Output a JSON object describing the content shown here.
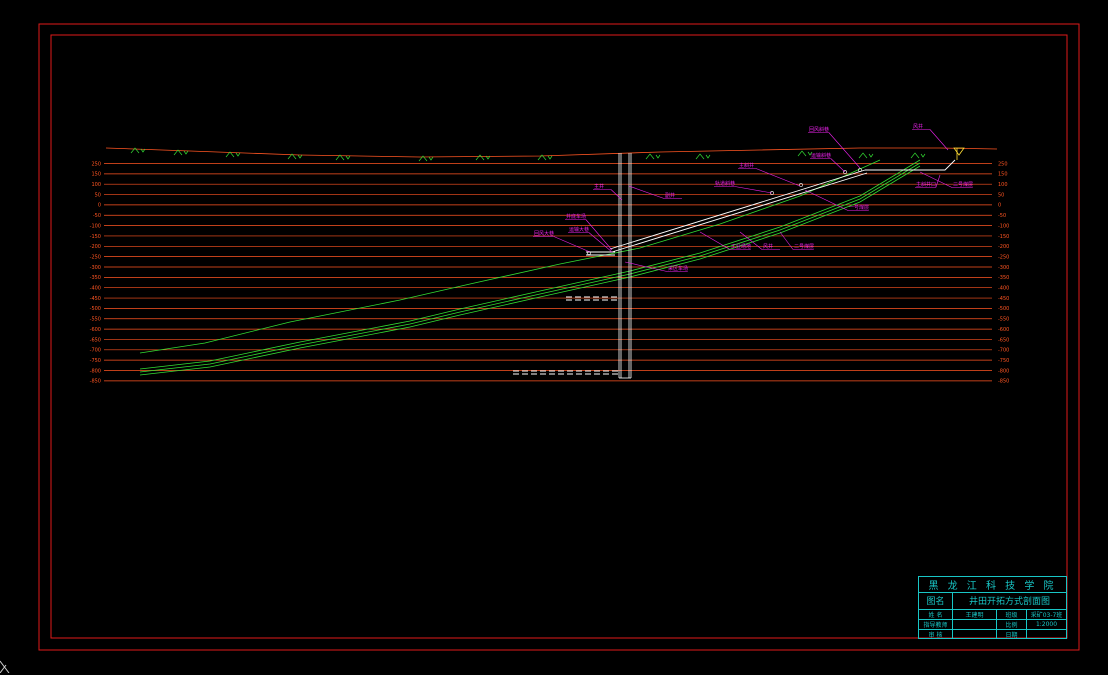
{
  "drawing": {
    "background": "#000000",
    "frame_color": "#e01a1a",
    "elevation_color": "#ff5522",
    "seam_color": "#33dd33",
    "workings_color": "#ffffff",
    "label_color": "#ee22ee",
    "vegetation_color": "#33dd33",
    "elevation_ticks_left": [
      "250",
      "150",
      "100",
      "50",
      "0",
      "-50",
      "-100",
      "-150",
      "-200",
      "-250",
      "-300",
      "-350",
      "-400",
      "-450",
      "-500",
      "-550",
      "-600",
      "-650",
      "-700",
      "-750",
      "-800",
      "-850"
    ],
    "elevation_ticks_right": [
      "250",
      "150",
      "100",
      "50",
      "0",
      "-50",
      "-100",
      "-150",
      "-200",
      "-250",
      "-300",
      "-350",
      "-400",
      "-450",
      "-500",
      "-550",
      "-600",
      "-650",
      "-700",
      "-750",
      "-800",
      "-850"
    ],
    "labels": [
      "风井",
      "回风斜巷",
      "运输斜巷",
      "主斜井",
      "主井",
      "副井",
      "轨道斜巷",
      "井底车场",
      "运输大巷",
      "回风大巷",
      "采区车场",
      "工业场地",
      "风井",
      "一号煤层",
      "二号煤层",
      "三号煤层",
      "主斜井口"
    ]
  },
  "title_block": {
    "school": "黑 龙 江 科 技 学 院",
    "title_label": "图名",
    "title": "井田开拓方式剖面图",
    "r3": [
      "姓 名",
      "王建明",
      "班级",
      "采矿03-7班"
    ],
    "r4": [
      "指导教师",
      "",
      "比例",
      "1:2000"
    ],
    "r5": [
      "审 核",
      "",
      "日期",
      ""
    ]
  }
}
